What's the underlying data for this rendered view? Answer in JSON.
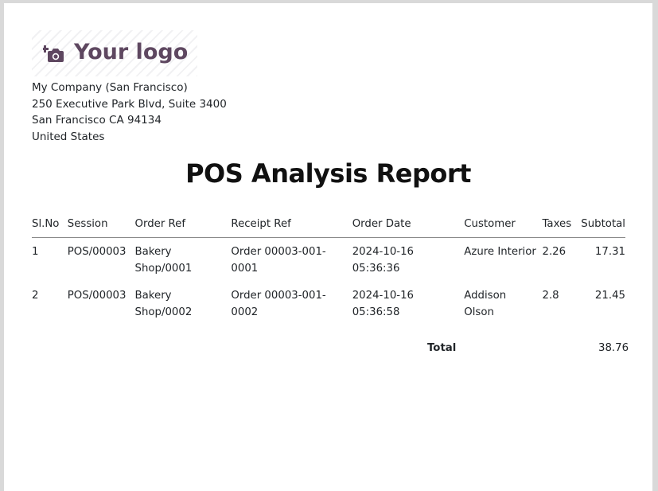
{
  "logo": {
    "text": "Your logo",
    "icon": "camera-plus-icon",
    "color": "#5e4760"
  },
  "company": {
    "name": "My Company (San Francisco)",
    "street": "250 Executive Park Blvd, Suite 3400",
    "city": "San Francisco CA 94134",
    "country": "United States"
  },
  "report": {
    "title": "POS Analysis Report"
  },
  "table": {
    "headers": {
      "slno": "Sl.No",
      "session": "Session",
      "order_ref": "Order Ref",
      "receipt_ref": "Receipt Ref",
      "order_date": "Order Date",
      "customer": "Customer",
      "taxes": "Taxes",
      "subtotal": "Subtotal"
    },
    "rows": [
      {
        "slno": "1",
        "session": "POS/00003",
        "order_ref_1": "Bakery",
        "order_ref_2": "Shop/0001",
        "receipt_ref_1": "Order 00003-001-",
        "receipt_ref_2": "0001",
        "date_1": "2024-10-16",
        "date_2": "05:36:36",
        "customer_1": "Azure Interior",
        "customer_2": "",
        "taxes": "2.26",
        "subtotal": "17.31"
      },
      {
        "slno": "2",
        "session": "POS/00003",
        "order_ref_1": "Bakery",
        "order_ref_2": "Shop/0002",
        "receipt_ref_1": "Order 00003-001-",
        "receipt_ref_2": "0002",
        "date_1": "2024-10-16",
        "date_2": "05:36:58",
        "customer_1": "Addison",
        "customer_2": "Olson",
        "taxes": "2.8",
        "subtotal": "21.45"
      }
    ]
  },
  "total": {
    "label": "Total",
    "value": "38.76"
  }
}
